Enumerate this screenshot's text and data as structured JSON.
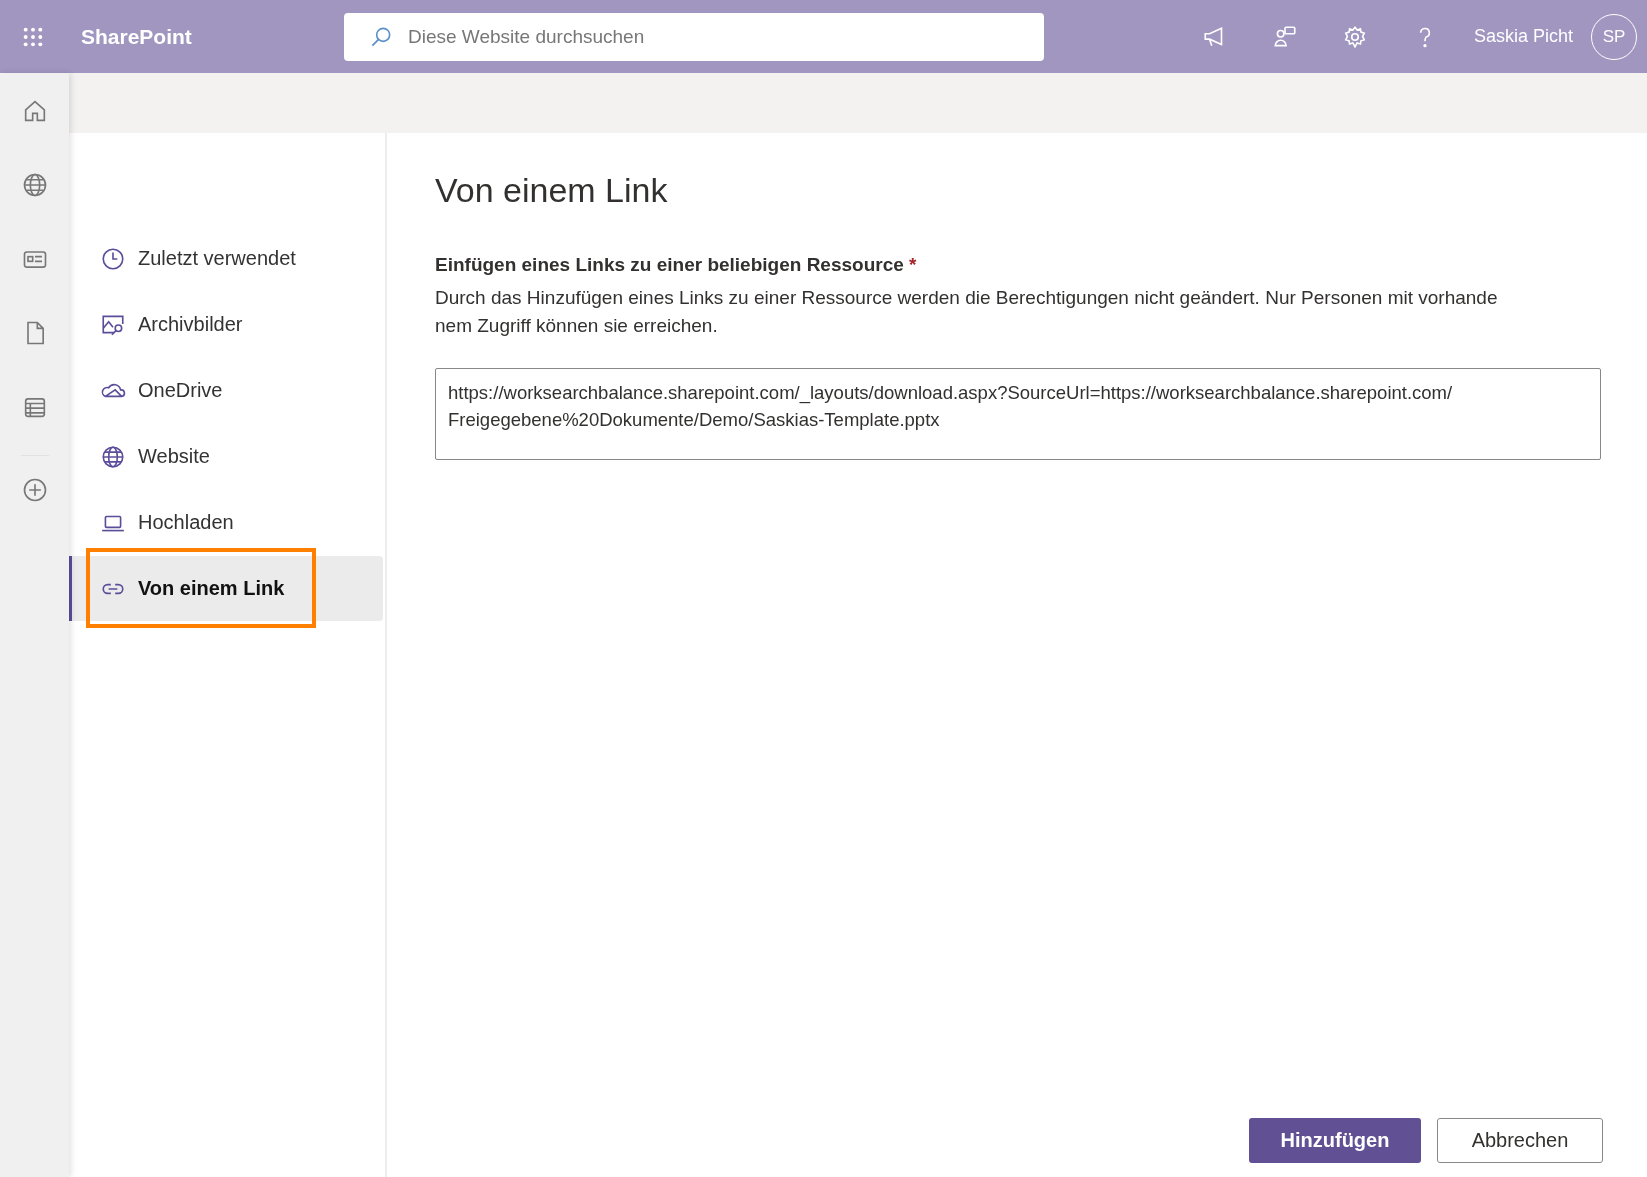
{
  "top_bar": {
    "app_name": "SharePoint",
    "search": {
      "placeholder": "Diese Website durchsuchen"
    },
    "user_name": "Saskia Picht",
    "avatar_initials": "SP"
  },
  "nav": [
    {
      "label": "Zuletzt verwendet",
      "selected": false
    },
    {
      "label": "Archivbilder",
      "selected": false
    },
    {
      "label": "OneDrive",
      "selected": false
    },
    {
      "label": "Website",
      "selected": false
    },
    {
      "label": "Hochladen",
      "selected": false
    },
    {
      "label": "Von einem Link",
      "selected": true,
      "highlighted": true
    }
  ],
  "content": {
    "title": "Von einem Link",
    "field_label": "Einfügen eines Links zu einer beliebigen Ressource",
    "required_mark": "*",
    "description_lines": [
      "Durch das Hinzufügen eines Links zu einer Ressource werden die Berechtigungen nicht geändert. Nur Personen mit vorhande",
      "nem Zugriff können sie erreichen."
    ],
    "url_lines": [
      "https://worksearchbalance.sharepoint.com/_layouts/download.aspx?SourceUrl=https://worksearchbalance.sharepoint.com/",
      "Freigegebene%20Dokumente/Demo/Saskias-Template.pptx"
    ]
  },
  "buttons": [
    {
      "label": "Hinzufügen",
      "kind": "primary"
    },
    {
      "label": "Abbrechen",
      "kind": "secondary"
    }
  ]
}
